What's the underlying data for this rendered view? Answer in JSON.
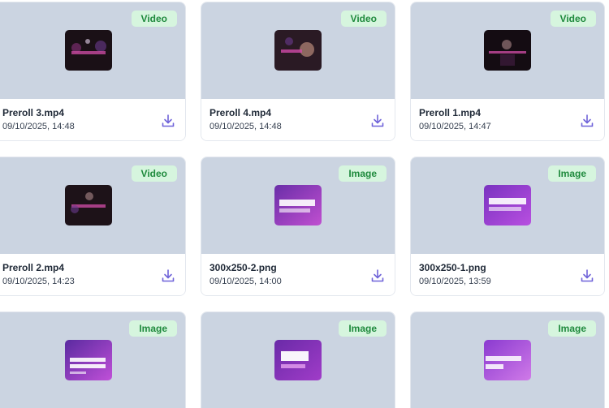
{
  "cards": [
    {
      "name": "Preroll 3.mp4",
      "date": "09/10/2025, 14:48",
      "badge": "Video",
      "kind": "video",
      "thumb_text": ""
    },
    {
      "name": "Preroll 4.mp4",
      "date": "09/10/2025, 14:48",
      "badge": "Video",
      "kind": "video",
      "thumb_text": ""
    },
    {
      "name": "Preroll 1.mp4",
      "date": "09/10/2025, 14:47",
      "badge": "Video",
      "kind": "video",
      "thumb_text": ""
    },
    {
      "name": "Preroll 2.mp4",
      "date": "09/10/2025, 14:23",
      "badge": "Video",
      "kind": "video",
      "thumb_text": ""
    },
    {
      "name": "300x250-2.png",
      "date": "09/10/2025, 14:00",
      "badge": "Image",
      "kind": "image",
      "thumb_text": "FREE LIVE SEX SHOWS"
    },
    {
      "name": "300x250-1.png",
      "date": "09/10/2025, 13:59",
      "badge": "Image",
      "kind": "image",
      "thumb_text": "FREE LIVE SEX SHOWS"
    },
    {
      "name": "",
      "date": "",
      "badge": "Image",
      "kind": "image",
      "thumb_text": "ENDLESS PLEASURE STARTS HERE"
    },
    {
      "name": "",
      "date": "",
      "badge": "Image",
      "kind": "image",
      "thumb_text": "LIVE SEX SHOWS"
    },
    {
      "name": "",
      "date": "",
      "badge": "Image",
      "kind": "image",
      "thumb_text": "PLEASURE HERE"
    }
  ],
  "colors": {
    "preview_bg": "#cbd4e1",
    "badge_bg": "#d6f5de",
    "badge_text": "#1f8a3d",
    "download_icon": "#6f63d9"
  },
  "icons": {
    "download": "download-icon"
  }
}
